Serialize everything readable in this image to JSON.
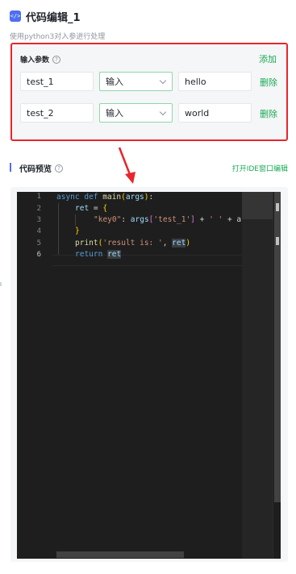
{
  "header": {
    "icon": "code-icon",
    "icon_glyph": "</>",
    "title": "代码编辑_1",
    "subtitle": "使用python3对入参进行处理"
  },
  "input_params": {
    "label": "输入参数",
    "help_glyph": "?",
    "add_label": "添加",
    "rows": [
      {
        "name": "test_1",
        "type": "输入",
        "value": "hello",
        "delete_label": "删除"
      },
      {
        "name": "test_2",
        "type": "输入",
        "value": "world",
        "delete_label": "删除"
      }
    ]
  },
  "code_preview": {
    "label": "代码预览",
    "help_glyph": "?",
    "open_ide_label": "打开IDE窗口编辑",
    "line_numbers": [
      "1",
      "2",
      "3",
      "4",
      "5",
      "6"
    ],
    "active_line": "6",
    "code": {
      "l1_async": "async",
      "l1_def": "def",
      "l1_name": "main",
      "l1_open": "(",
      "l1_arg": "args",
      "l1_close": ")",
      "l1_colon": ":",
      "l2_var": "ret",
      "l2_eq": " = ",
      "l2_brace": "{",
      "l3_key": "\"key0\"",
      "l3_colon": ": ",
      "l3_args": "args",
      "l3_lb": "[",
      "l3_str": "'test_1'",
      "l3_rb": "]",
      "l3_plus1": " + ",
      "l3_space": "' '",
      "l3_plus2": " + a",
      "l4_brace": "}",
      "l5_print": "print",
      "l5_open": "(",
      "l5_str": "'result is: '",
      "l5_comma": ", ",
      "l5_ret": "ret",
      "l5_close": ")",
      "l6_return": "return",
      "l6_ret": "ret"
    }
  },
  "colors": {
    "accent_green": "#1aaa55",
    "highlight_red": "#e8252b",
    "brand_blue": "#4e6ef2",
    "editor_bg": "#1e1e1e"
  }
}
